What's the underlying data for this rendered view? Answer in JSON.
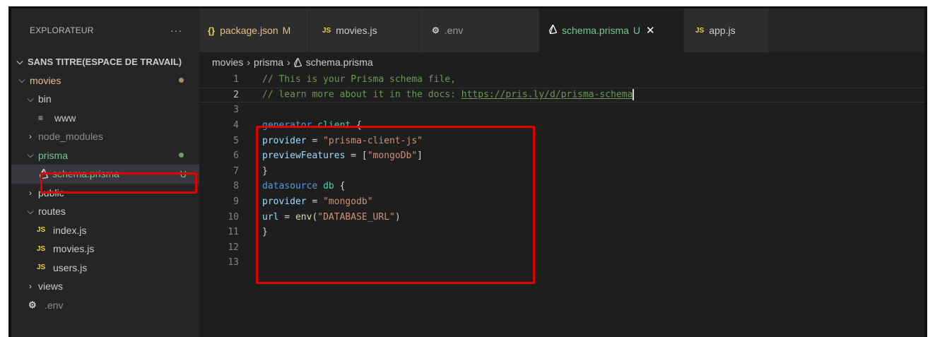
{
  "sidebar": {
    "title": "EXPLORATEUR",
    "more": "···",
    "workspace": "SANS TITRE(ESPACE DE TRAVAIL)",
    "items": [
      {
        "label": "movies",
        "chev": "⌵"
      },
      {
        "label": "bin",
        "chev": "⌵"
      },
      {
        "label": "www"
      },
      {
        "label": "node_modules",
        "chev": "›"
      },
      {
        "label": "prisma",
        "chev": "⌵"
      },
      {
        "label": "schema.prisma",
        "badge": "U"
      },
      {
        "label": "public",
        "chev": "›"
      },
      {
        "label": "routes",
        "chev": "⌵"
      },
      {
        "label": "index.js"
      },
      {
        "label": "movies.js"
      },
      {
        "label": "users.js"
      },
      {
        "label": "views",
        "chev": "›"
      },
      {
        "label": ".env"
      }
    ]
  },
  "tabs": [
    {
      "label": "package.json",
      "status": "M",
      "icon": "{}"
    },
    {
      "label": "movies.js",
      "icon": "JS"
    },
    {
      "label": ".env",
      "icon": "⚙"
    },
    {
      "label": "schema.prisma",
      "status": "U",
      "close": "✕"
    },
    {
      "label": "app.js",
      "icon": "JS"
    }
  ],
  "breadcrumb": {
    "parts": [
      "movies",
      "prisma",
      "schema.prisma"
    ],
    "sep": "›"
  },
  "editor": {
    "line_numbers": [
      "1",
      "2",
      "3",
      "4",
      "5",
      "6",
      "7",
      "8",
      "9",
      "10",
      "11",
      "12",
      "13"
    ],
    "lines": {
      "l1": "// This is your Prisma schema file,",
      "l2a": "// learn more about it in the docs: ",
      "l2b": "https://pris.ly/d/prisma-schema",
      "l4a": "generator",
      "l4b": "client",
      "l4c": "{",
      "l5a": "provider",
      "l5b": "=",
      "l5c": "\"prisma-client-js\"",
      "l6a": "previewFeatures",
      "l6b": "=",
      "l6c": "[",
      "l6d": "\"mongoDb\"",
      "l6e": "]",
      "l7": "}",
      "l8a": "datasource",
      "l8b": "db",
      "l8c": "{",
      "l9a": "provider",
      "l9b": "=",
      "l9c": "\"mongodb\"",
      "l10a": "url",
      "l10b": "=",
      "l10c": "env",
      "l10d": "(",
      "l10e": "\"DATABASE_URL\"",
      "l10f": ")",
      "l11": "}"
    }
  },
  "colors": {
    "highlight_box": "#e00000",
    "git_untracked": "#73c991",
    "git_modified": "#e2c08d"
  }
}
